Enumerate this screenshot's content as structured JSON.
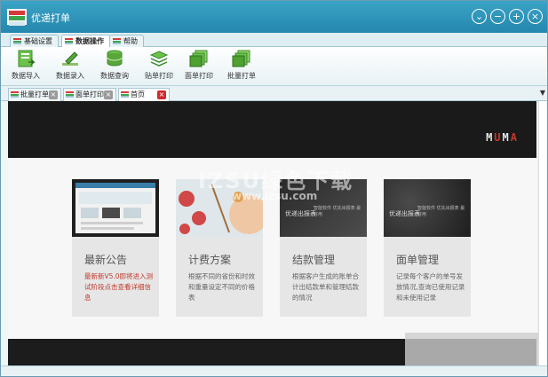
{
  "window": {
    "title": "优递打单",
    "controls": [
      "chevron-down-icon",
      "minimize-icon",
      "maximize-icon",
      "close-icon"
    ]
  },
  "menu_tabs": [
    {
      "label": "基础设置",
      "active": false
    },
    {
      "label": "数据操作",
      "active": true
    },
    {
      "label": "帮助",
      "active": false
    }
  ],
  "toolbar": [
    {
      "label": "数据导入",
      "icon": "import-icon"
    },
    {
      "label": "数据录入",
      "icon": "pen-entry-icon"
    },
    {
      "label": "数据查询",
      "icon": "database-icon"
    },
    {
      "label": "贴单打印",
      "icon": "layers-icon"
    },
    {
      "label": "面单打印",
      "icon": "print-stack-icon"
    },
    {
      "label": "批量打单",
      "icon": "batch-print-icon"
    }
  ],
  "doc_tabs": [
    {
      "label": "批量打单",
      "close": "grey"
    },
    {
      "label": "面单打印",
      "close": "grey"
    },
    {
      "label": "首页",
      "close": "red",
      "active": true
    }
  ],
  "hero": {
    "brand_parts": [
      "M",
      "U",
      "M",
      "A"
    ]
  },
  "cards": [
    {
      "title": "最新公告",
      "desc": "最新新V5.0即将进入测试阶段点击查看详细信息",
      "desc_color": "#c0392b"
    },
    {
      "title": "计费方案",
      "desc": "根据不同的省份和时效和重量设定不同的价格表"
    },
    {
      "title": "结款管理",
      "desc": "根据客户生成的账单合计出结款单和管理结款的情况",
      "thumb_title": "优递出报表",
      "thumb_sub": "智能软件 优先出报表 最好用"
    },
    {
      "title": "面单管理",
      "desc": "记录每个客户的单号发放情况,查询已使用记录和未使用记录",
      "thumb_title": "优递出报表",
      "thumb_sub": "智能软件 优先出报表 最好用"
    }
  ],
  "watermark": {
    "line1": "IZSU绿色下载",
    "line2": "www.izsu.com"
  },
  "colors": {
    "titlebar": "#2587ad",
    "accent_red": "#c0392b",
    "hero_bg": "#1a1a1a",
    "card_bg": "#e6e6e6"
  }
}
